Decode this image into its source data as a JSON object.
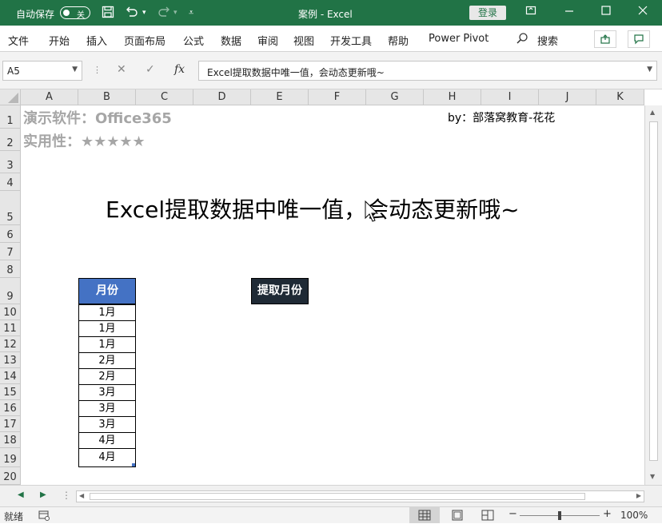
{
  "titlebar": {
    "autosave_label": "自动保存",
    "autosave_state": "关",
    "doc_title": "案例  -  Excel",
    "login_label": "登录"
  },
  "menu": {
    "items": [
      "文件",
      "开始",
      "插入",
      "页面布局",
      "公式",
      "数据",
      "审阅",
      "视图",
      "开发工具",
      "帮助",
      "Power Pivot"
    ],
    "search": "搜索"
  },
  "formula_bar": {
    "name_box": "A5",
    "fx_label": "fx",
    "content": "Excel提取数据中唯一值，会动态更新哦~"
  },
  "columns": [
    "A",
    "B",
    "C",
    "D",
    "E",
    "F",
    "G",
    "H",
    "I",
    "J",
    "K"
  ],
  "rows": [
    "1",
    "2",
    "3",
    "4",
    "5",
    "6",
    "7",
    "8",
    "9",
    "10",
    "11",
    "12",
    "13",
    "14",
    "15",
    "16",
    "17",
    "18",
    "19",
    "20"
  ],
  "sheet": {
    "demo_software": "演示软件：Office365",
    "practicality": "实用性：★★★★★",
    "byline": "by：部落窝教育-花花",
    "main_title": "Excel提取数据中唯一值，会动态更新哦~",
    "month_header": "月份",
    "months": [
      "1月",
      "1月",
      "1月",
      "2月",
      "2月",
      "3月",
      "3月",
      "3月",
      "4月",
      "4月"
    ],
    "extract_header": "提取月份"
  },
  "colors": {
    "excel_green": "#217346",
    "header_blue": "#4472c4",
    "extract_dark": "#1f2a35",
    "faded_text": "#a6a6a6"
  },
  "status": {
    "ready": "就绪",
    "zoom": "100%"
  }
}
